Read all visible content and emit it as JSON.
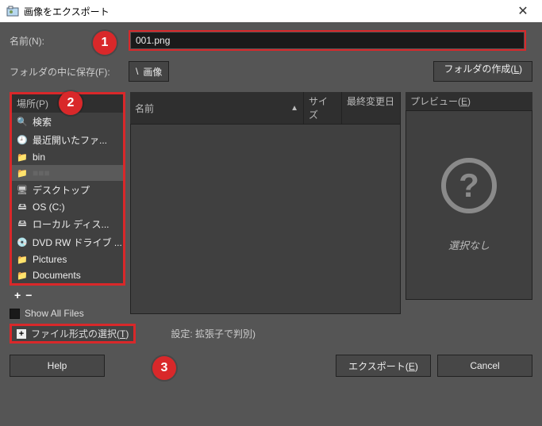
{
  "window": {
    "title": "画像をエクスポート",
    "close": "✕"
  },
  "name_row": {
    "label": "名前(N):",
    "value": "001.png"
  },
  "folder_row": {
    "label": "フォルダの中に保存(F):",
    "path_sep": "\\",
    "path_folder": "画像",
    "create_label": "フォルダの作成(L)"
  },
  "places": {
    "header": "場所(P)",
    "items": [
      {
        "icon": "search",
        "label": "検索"
      },
      {
        "icon": "recent",
        "label": "最近開いたファ..."
      },
      {
        "icon": "folder",
        "label": "bin"
      },
      {
        "icon": "folder",
        "label": ""
      },
      {
        "icon": "desktop",
        "label": "デスクトップ"
      },
      {
        "icon": "drive",
        "label": "OS (C:)"
      },
      {
        "icon": "drive",
        "label": "ローカル ディス..."
      },
      {
        "icon": "disc",
        "label": "DVD RW ドライブ ..."
      },
      {
        "icon": "folder",
        "label": "Pictures"
      },
      {
        "icon": "folder",
        "label": "Documents"
      }
    ],
    "add": "+",
    "remove": "−"
  },
  "filelist": {
    "cols": {
      "name": "名前",
      "size": "サイズ",
      "mod": "最終変更日"
    },
    "sort_indicator": "▲"
  },
  "preview": {
    "header": "プレビュー(E)",
    "glyph": "?",
    "empty": "選択なし"
  },
  "options": {
    "show_all": "Show All Files",
    "filetype_label": "ファイル形式の選択(T)",
    "filetype_note": "設定: 拡張子で判別)",
    "expand_glyph": "+"
  },
  "buttons": {
    "help": "Help",
    "export": "エクスポート(E)",
    "cancel": "Cancel"
  },
  "callouts": {
    "c1": "1",
    "c2": "2",
    "c3": "3"
  }
}
